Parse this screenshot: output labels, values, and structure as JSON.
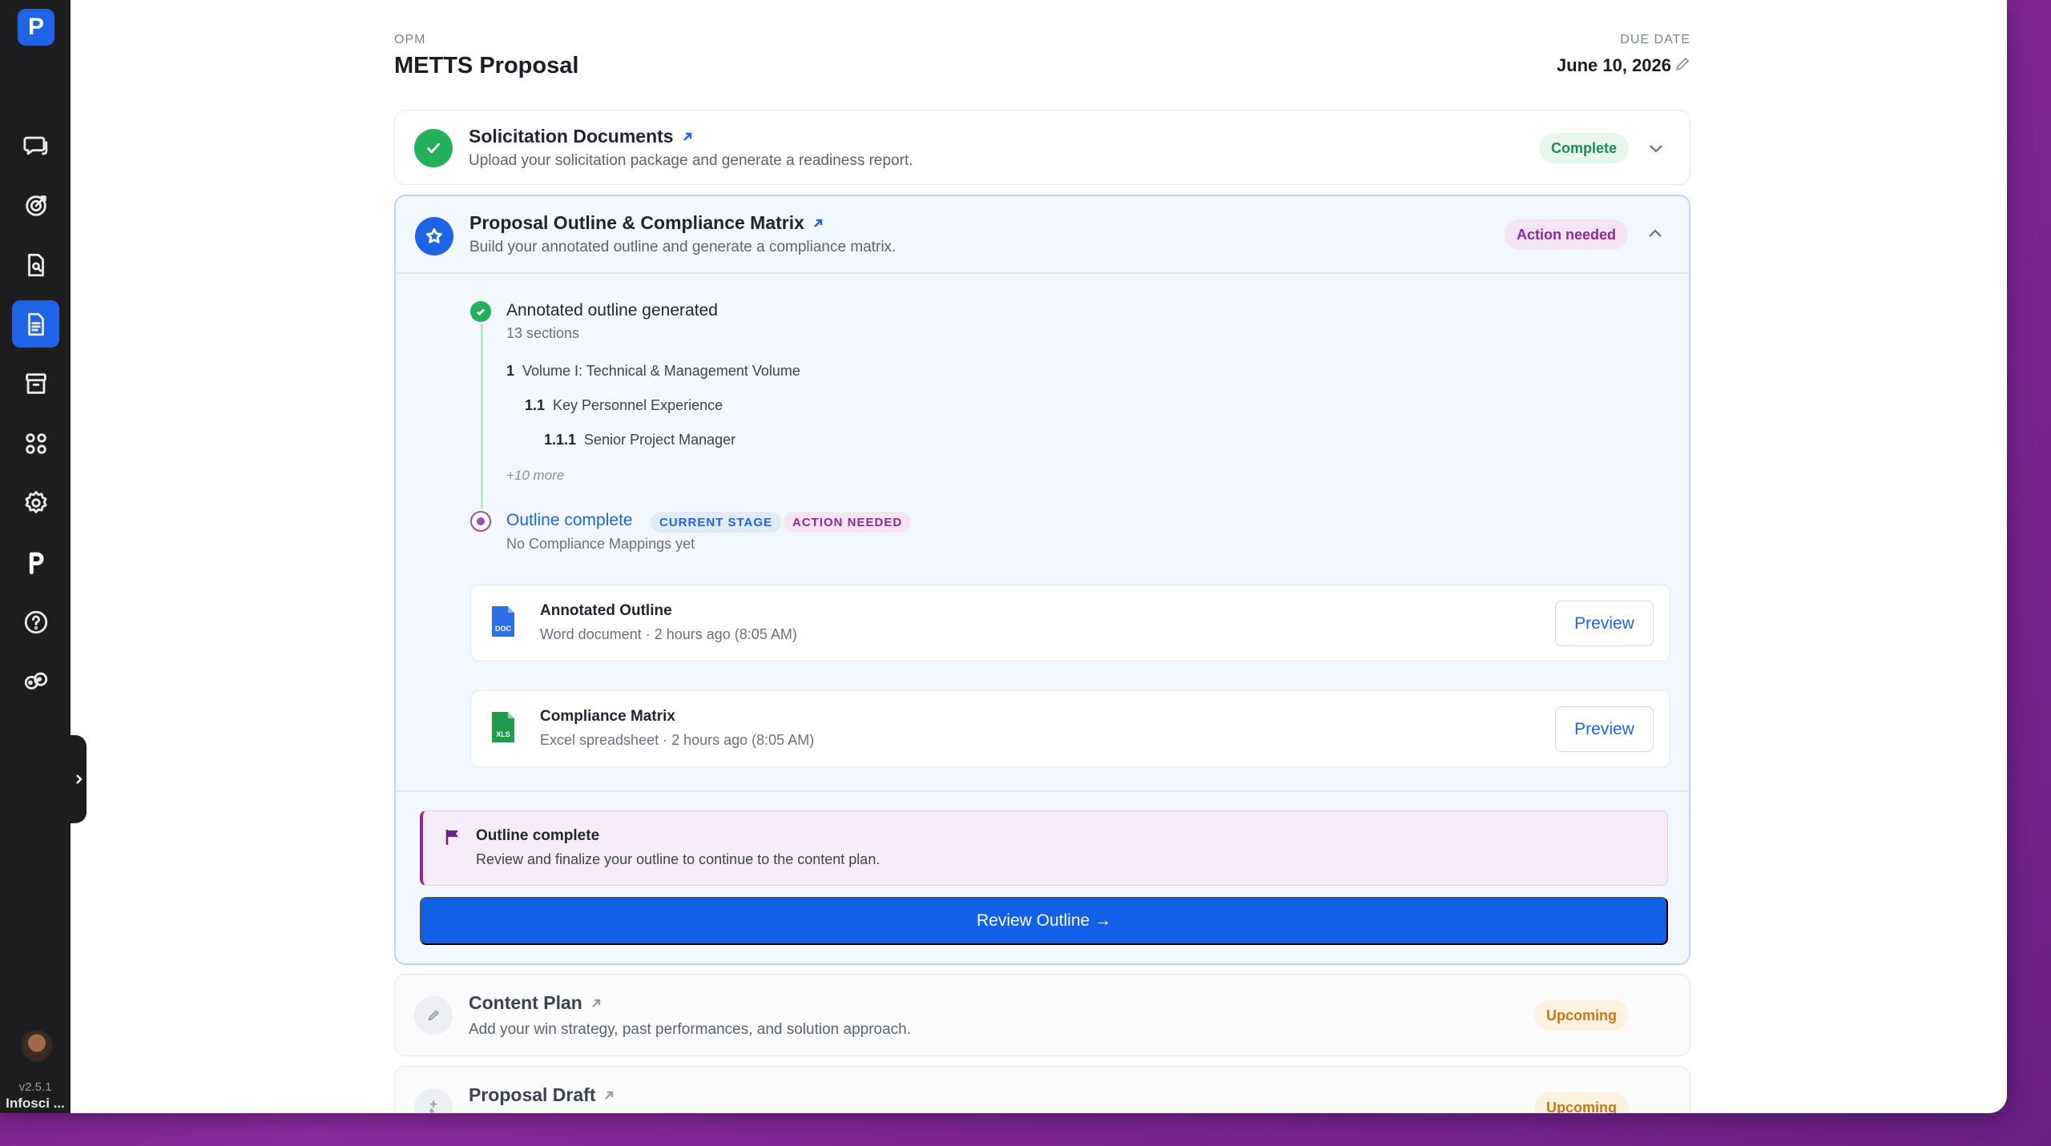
{
  "sidebar": {
    "logo": "P",
    "version": "v2.5.1",
    "org": "Infosci ...",
    "items": [
      "chat-icon",
      "target-icon",
      "document-search-icon",
      "document-icon",
      "archive-icon",
      "apps-grid-icon",
      "settings-icon",
      "brand-p-icon",
      "help-icon",
      "team-icon"
    ]
  },
  "header": {
    "agency": "OPM",
    "title": "METTS Proposal",
    "due_label": "DUE DATE",
    "due_date": "June 10, 2026"
  },
  "steps": [
    {
      "title": "Solicitation Documents",
      "subtitle": "Upload your solicitation package and generate a readiness report.",
      "status": "Complete"
    },
    {
      "title": "Proposal Outline & Compliance Matrix",
      "subtitle": "Build your annotated outline and generate a compliance matrix.",
      "status": "Action needed",
      "timeline": {
        "first": {
          "title": "Annotated outline generated",
          "subtitle": "13 sections",
          "outline": [
            {
              "num": "1",
              "label": "Volume I: Technical & Management Volume"
            },
            {
              "num": "1.1",
              "label": "Key Personnel Experience"
            },
            {
              "num": "1.1.1",
              "label": "Senior Project Manager"
            }
          ],
          "more": "+10 more"
        },
        "second": {
          "title": "Outline complete",
          "tag_stage": "CURRENT STAGE",
          "tag_action": "ACTION NEEDED",
          "subtitle": "No Compliance Mappings yet"
        }
      },
      "files": [
        {
          "name": "Annotated Outline",
          "meta": "Word document · 2 hours ago (8:05 AM)",
          "badge": "DOC",
          "action": "Preview"
        },
        {
          "name": "Compliance Matrix",
          "meta": "Excel spreadsheet · 2 hours ago (8:05 AM)",
          "badge": "XLS",
          "action": "Preview"
        }
      ],
      "notice": {
        "title": "Outline complete",
        "text": "Review and finalize your outline to continue to the content plan."
      },
      "cta": "Review Outline →"
    },
    {
      "title": "Content Plan",
      "subtitle": "Add your win strategy, past performances, and solution approach.",
      "status": "Upcoming"
    },
    {
      "title": "Proposal Draft",
      "subtitle": "",
      "status": "Upcoming"
    }
  ],
  "colors": {
    "primary": "#1260e8",
    "success": "#22b05a",
    "action": "#8c2a96",
    "upcoming": "#c07a1a",
    "sidebar": "#1d1d1f"
  }
}
